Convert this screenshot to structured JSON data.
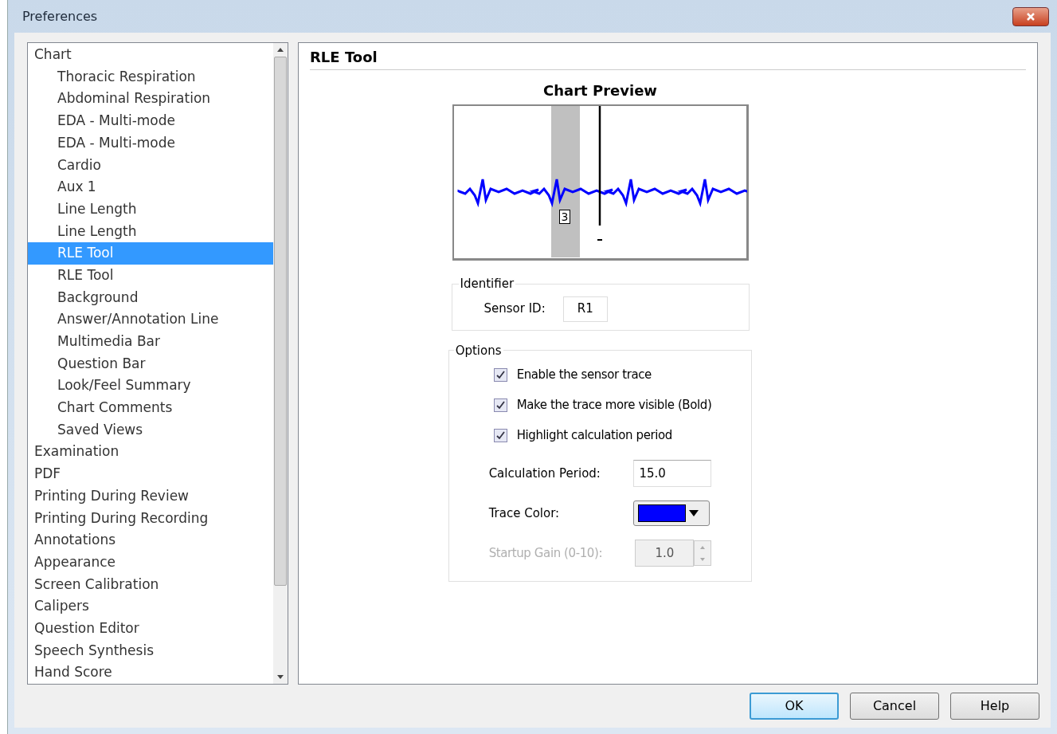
{
  "window": {
    "title": "Preferences"
  },
  "tree": [
    {
      "label": "Chart",
      "selected": false,
      "children": [
        {
          "label": "Thoracic Respiration",
          "selected": false
        },
        {
          "label": "Abdominal Respiration",
          "selected": false
        },
        {
          "label": "EDA - Multi-mode",
          "selected": false
        },
        {
          "label": "EDA - Multi-mode",
          "selected": false
        },
        {
          "label": "Cardio",
          "selected": false
        },
        {
          "label": "Aux 1",
          "selected": false
        },
        {
          "label": "Line Length",
          "selected": false
        },
        {
          "label": "Line Length",
          "selected": false
        },
        {
          "label": "RLE Tool",
          "selected": true
        },
        {
          "label": "RLE Tool",
          "selected": false
        },
        {
          "label": "Background",
          "selected": false
        },
        {
          "label": "Answer/Annotation Line",
          "selected": false
        },
        {
          "label": "Multimedia Bar",
          "selected": false
        },
        {
          "label": "Question Bar",
          "selected": false
        },
        {
          "label": "Look/Feel Summary",
          "selected": false
        },
        {
          "label": "Chart Comments",
          "selected": false
        },
        {
          "label": "Saved Views",
          "selected": false
        }
      ]
    },
    {
      "label": "Examination",
      "selected": false
    },
    {
      "label": "PDF",
      "selected": false
    },
    {
      "label": "Printing During Review",
      "selected": false
    },
    {
      "label": "Printing During Recording",
      "selected": false
    },
    {
      "label": "Annotations",
      "selected": false
    },
    {
      "label": "Appearance",
      "selected": false
    },
    {
      "label": "Screen Calibration",
      "selected": false
    },
    {
      "label": "Calipers",
      "selected": false
    },
    {
      "label": "Question Editor",
      "selected": false
    },
    {
      "label": "Speech Synthesis",
      "selected": false
    },
    {
      "label": "Hand Score",
      "selected": false
    }
  ],
  "panel": {
    "title": "RLE Tool",
    "preview": {
      "title": "Chart Preview",
      "marker_label": "3"
    },
    "identifier": {
      "legend": "Identifier",
      "label": "Sensor ID:",
      "value": "R1"
    },
    "options": {
      "legend": "Options",
      "checkboxes": [
        {
          "label": "Enable the sensor trace",
          "checked": true
        },
        {
          "label": "Make the trace more visible (Bold)",
          "checked": true
        },
        {
          "label": "Highlight calculation period",
          "checked": true
        }
      ],
      "calculation_period": {
        "label": "Calculation Period:",
        "value": "15.0"
      },
      "trace_color": {
        "label": "Trace Color:",
        "color": "#0000ff"
      },
      "startup_gain": {
        "label": "Startup Gain (0-10):",
        "value": "1.0",
        "disabled": true
      }
    }
  },
  "buttons": [
    {
      "label": "OK",
      "kind": "default"
    },
    {
      "label": "Cancel",
      "kind": "normal"
    },
    {
      "label": "Help",
      "kind": "normal"
    }
  ]
}
